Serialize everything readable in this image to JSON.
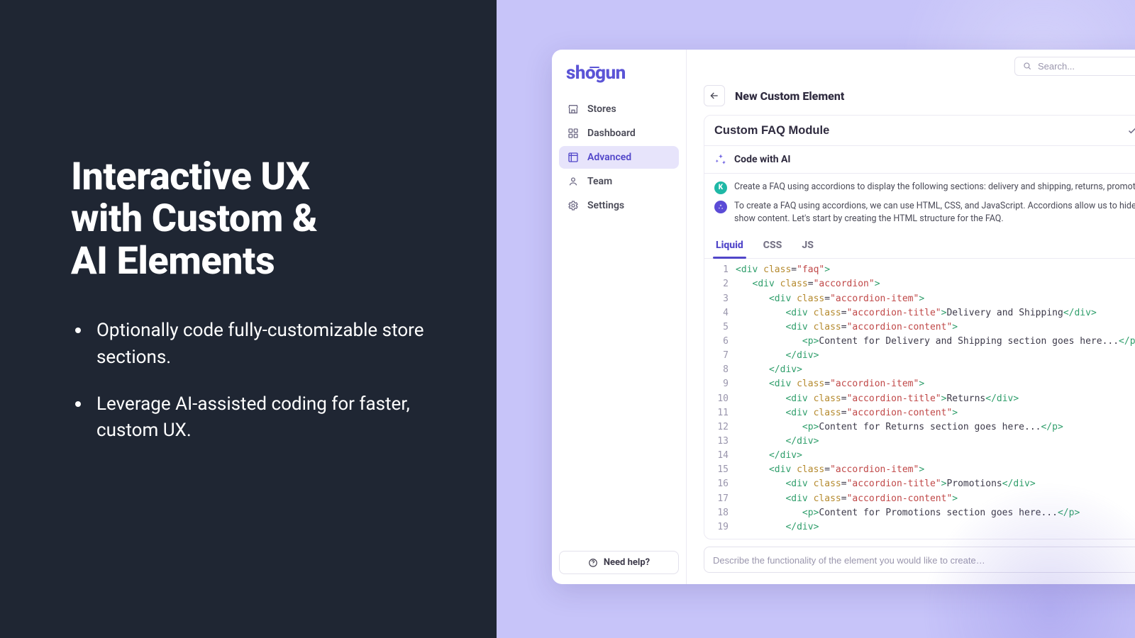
{
  "marketing": {
    "headline_l1": "Interactive UX",
    "headline_l2": "with Custom &",
    "headline_l3": "AI Elements",
    "bullets": [
      "Optionally code fully-customizable store sections.",
      "Leverage AI-assisted coding for faster, custom UX."
    ]
  },
  "brand": {
    "name": "shogun"
  },
  "search": {
    "placeholder": "Search..."
  },
  "sidebar": {
    "items": [
      {
        "id": "stores",
        "label": "Stores"
      },
      {
        "id": "dashboard",
        "label": "Dashboard"
      },
      {
        "id": "advanced",
        "label": "Advanced",
        "active": true
      },
      {
        "id": "team",
        "label": "Team"
      },
      {
        "id": "settings",
        "label": "Settings"
      }
    ],
    "need_help": "Need help?"
  },
  "page": {
    "title": "New Custom Element",
    "element_name": "Custom FAQ Module",
    "code_with_ai": "Code with AI"
  },
  "chat": {
    "user_initial": "K",
    "user_msg": "Create a FAQ using accordions to display the following sections: delivery and shipping, returns, promotions.",
    "ai_msg": "To create a FAQ using accordions, we can use HTML, CSS, and JavaScript. Accordions allow us to hide and show content. Let's start by creating the HTML structure for the FAQ."
  },
  "tabs": [
    {
      "id": "liquid",
      "label": "Liquid",
      "active": true
    },
    {
      "id": "css",
      "label": "CSS"
    },
    {
      "id": "js",
      "label": "JS"
    }
  ],
  "code": {
    "lines": [
      {
        "n": 1,
        "indent": 0,
        "kind": "open",
        "tag": "div",
        "cls": "faq"
      },
      {
        "n": 2,
        "indent": 1,
        "kind": "open",
        "tag": "div",
        "cls": "accordion"
      },
      {
        "n": 3,
        "indent": 2,
        "kind": "open",
        "tag": "div",
        "cls": "accordion-item"
      },
      {
        "n": 4,
        "indent": 3,
        "kind": "openclose",
        "tag": "div",
        "cls": "accordion-title",
        "text": "Delivery and Shipping"
      },
      {
        "n": 5,
        "indent": 3,
        "kind": "open",
        "tag": "div",
        "cls": "accordion-content"
      },
      {
        "n": 6,
        "indent": 4,
        "kind": "openclose",
        "tag": "p",
        "text": "Content for Delivery and Shipping section goes here..."
      },
      {
        "n": 7,
        "indent": 3,
        "kind": "close",
        "tag": "div"
      },
      {
        "n": 8,
        "indent": 2,
        "kind": "close",
        "tag": "div"
      },
      {
        "n": 9,
        "indent": 2,
        "kind": "open",
        "tag": "div",
        "cls": "accordion-item"
      },
      {
        "n": 10,
        "indent": 3,
        "kind": "openclose",
        "tag": "div",
        "cls": "accordion-title",
        "text": "Returns"
      },
      {
        "n": 11,
        "indent": 3,
        "kind": "open",
        "tag": "div",
        "cls": "accordion-content"
      },
      {
        "n": 12,
        "indent": 4,
        "kind": "openclose",
        "tag": "p",
        "text": "Content for Returns section goes here..."
      },
      {
        "n": 13,
        "indent": 3,
        "kind": "close",
        "tag": "div"
      },
      {
        "n": 14,
        "indent": 2,
        "kind": "close",
        "tag": "div"
      },
      {
        "n": 15,
        "indent": 2,
        "kind": "open",
        "tag": "div",
        "cls": "accordion-item"
      },
      {
        "n": 16,
        "indent": 3,
        "kind": "openclose",
        "tag": "div",
        "cls": "accordion-title",
        "text": "Promotions"
      },
      {
        "n": 17,
        "indent": 3,
        "kind": "open",
        "tag": "div",
        "cls": "accordion-content"
      },
      {
        "n": 18,
        "indent": 4,
        "kind": "openclose",
        "tag": "p",
        "text": "Content for Promotions section goes here..."
      },
      {
        "n": 19,
        "indent": 3,
        "kind": "close",
        "tag": "div"
      }
    ]
  },
  "prompt": {
    "placeholder": "Describe the functionality of the element you would like to create…"
  }
}
